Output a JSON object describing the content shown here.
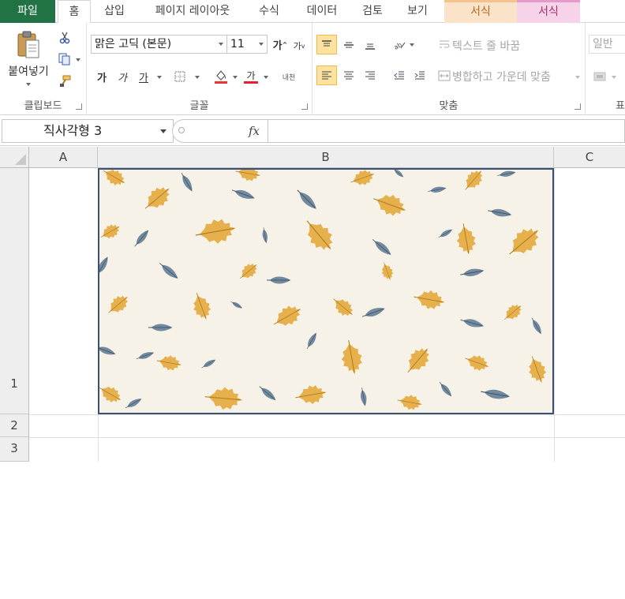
{
  "tabs": {
    "file": "파일",
    "home": "홈",
    "insert": "삽입",
    "page_layout": "페이지 레이아웃",
    "formulas": "수식",
    "data": "데이터",
    "review": "검토",
    "view": "보기",
    "format1": "서식",
    "format2": "서식"
  },
  "clipboard": {
    "paste_label": "붙여넣기",
    "group_label": "클립보드"
  },
  "font": {
    "name": "맑은 고딕 (본문)",
    "size": "11",
    "grow": "가",
    "shrink": "가",
    "bold": "가",
    "italic": "가",
    "underline": "가",
    "font_color_glyph": "가",
    "phonetic": "내천",
    "group_label": "글꼴"
  },
  "alignment": {
    "wrap_text": "텍스트 줄 바꿈",
    "merge_center": "병합하고 가운데 맞춤",
    "group_label": "맞춤"
  },
  "number": {
    "format": "일반",
    "group_label_partial": "표"
  },
  "formula_bar": {
    "name_box": "직사각형 3",
    "fx": "fx",
    "content": ""
  },
  "grid": {
    "columns": [
      "A",
      "B",
      "C"
    ],
    "rows": [
      "1",
      "2",
      "3"
    ]
  },
  "shape": {
    "description_colors": {
      "background": "#f7f2e7",
      "leaf_orange": "#e3a83c",
      "leaf_blue": "#647d95",
      "border": "#3a4f74"
    }
  }
}
